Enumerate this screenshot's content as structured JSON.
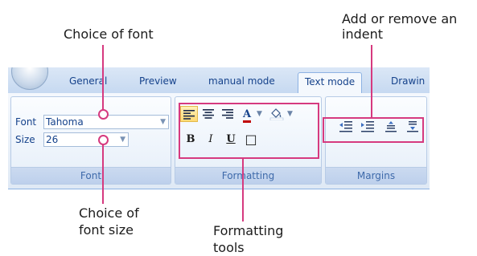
{
  "callouts": {
    "choice_of_font": "Choice of font",
    "add_remove_indent_line1": "Add or remove an",
    "add_remove_indent_line2": "indent",
    "choice_of_font_size_line1": "Choice of",
    "choice_of_font_size_line2": "font size",
    "formatting_tools_line1": "Formatting",
    "formatting_tools_line2": "tools"
  },
  "ribbon": {
    "tabs": [
      "General",
      "Preview",
      "manual mode",
      "Text mode",
      "Drawin"
    ],
    "active_tab": "Text mode",
    "groups": {
      "font": {
        "label": "Font",
        "font_label": "Font",
        "font_value": "Tahoma",
        "size_label": "Size",
        "size_value": "26"
      },
      "formatting": {
        "label": "Formatting",
        "bold": "B",
        "italic": "I",
        "underline": "U",
        "border": "□",
        "font_color_letter": "A"
      },
      "margins": {
        "label": "Margins"
      }
    }
  },
  "icons": {
    "align_left": "align-left-icon",
    "align_center": "align-center-icon",
    "align_right": "align-right-icon",
    "font_color": "font-color-icon",
    "fill_color": "fill-color-icon",
    "decrease_indent": "decrease-indent-icon",
    "increase_indent": "increase-indent-icon",
    "decrease_spacing": "decrease-spacing-icon",
    "increase_spacing": "increase-spacing-icon"
  },
  "colors": {
    "callout_accent": "#d63a7f",
    "ribbon_text": "#15428b",
    "font_color_bar": "#c00000"
  }
}
